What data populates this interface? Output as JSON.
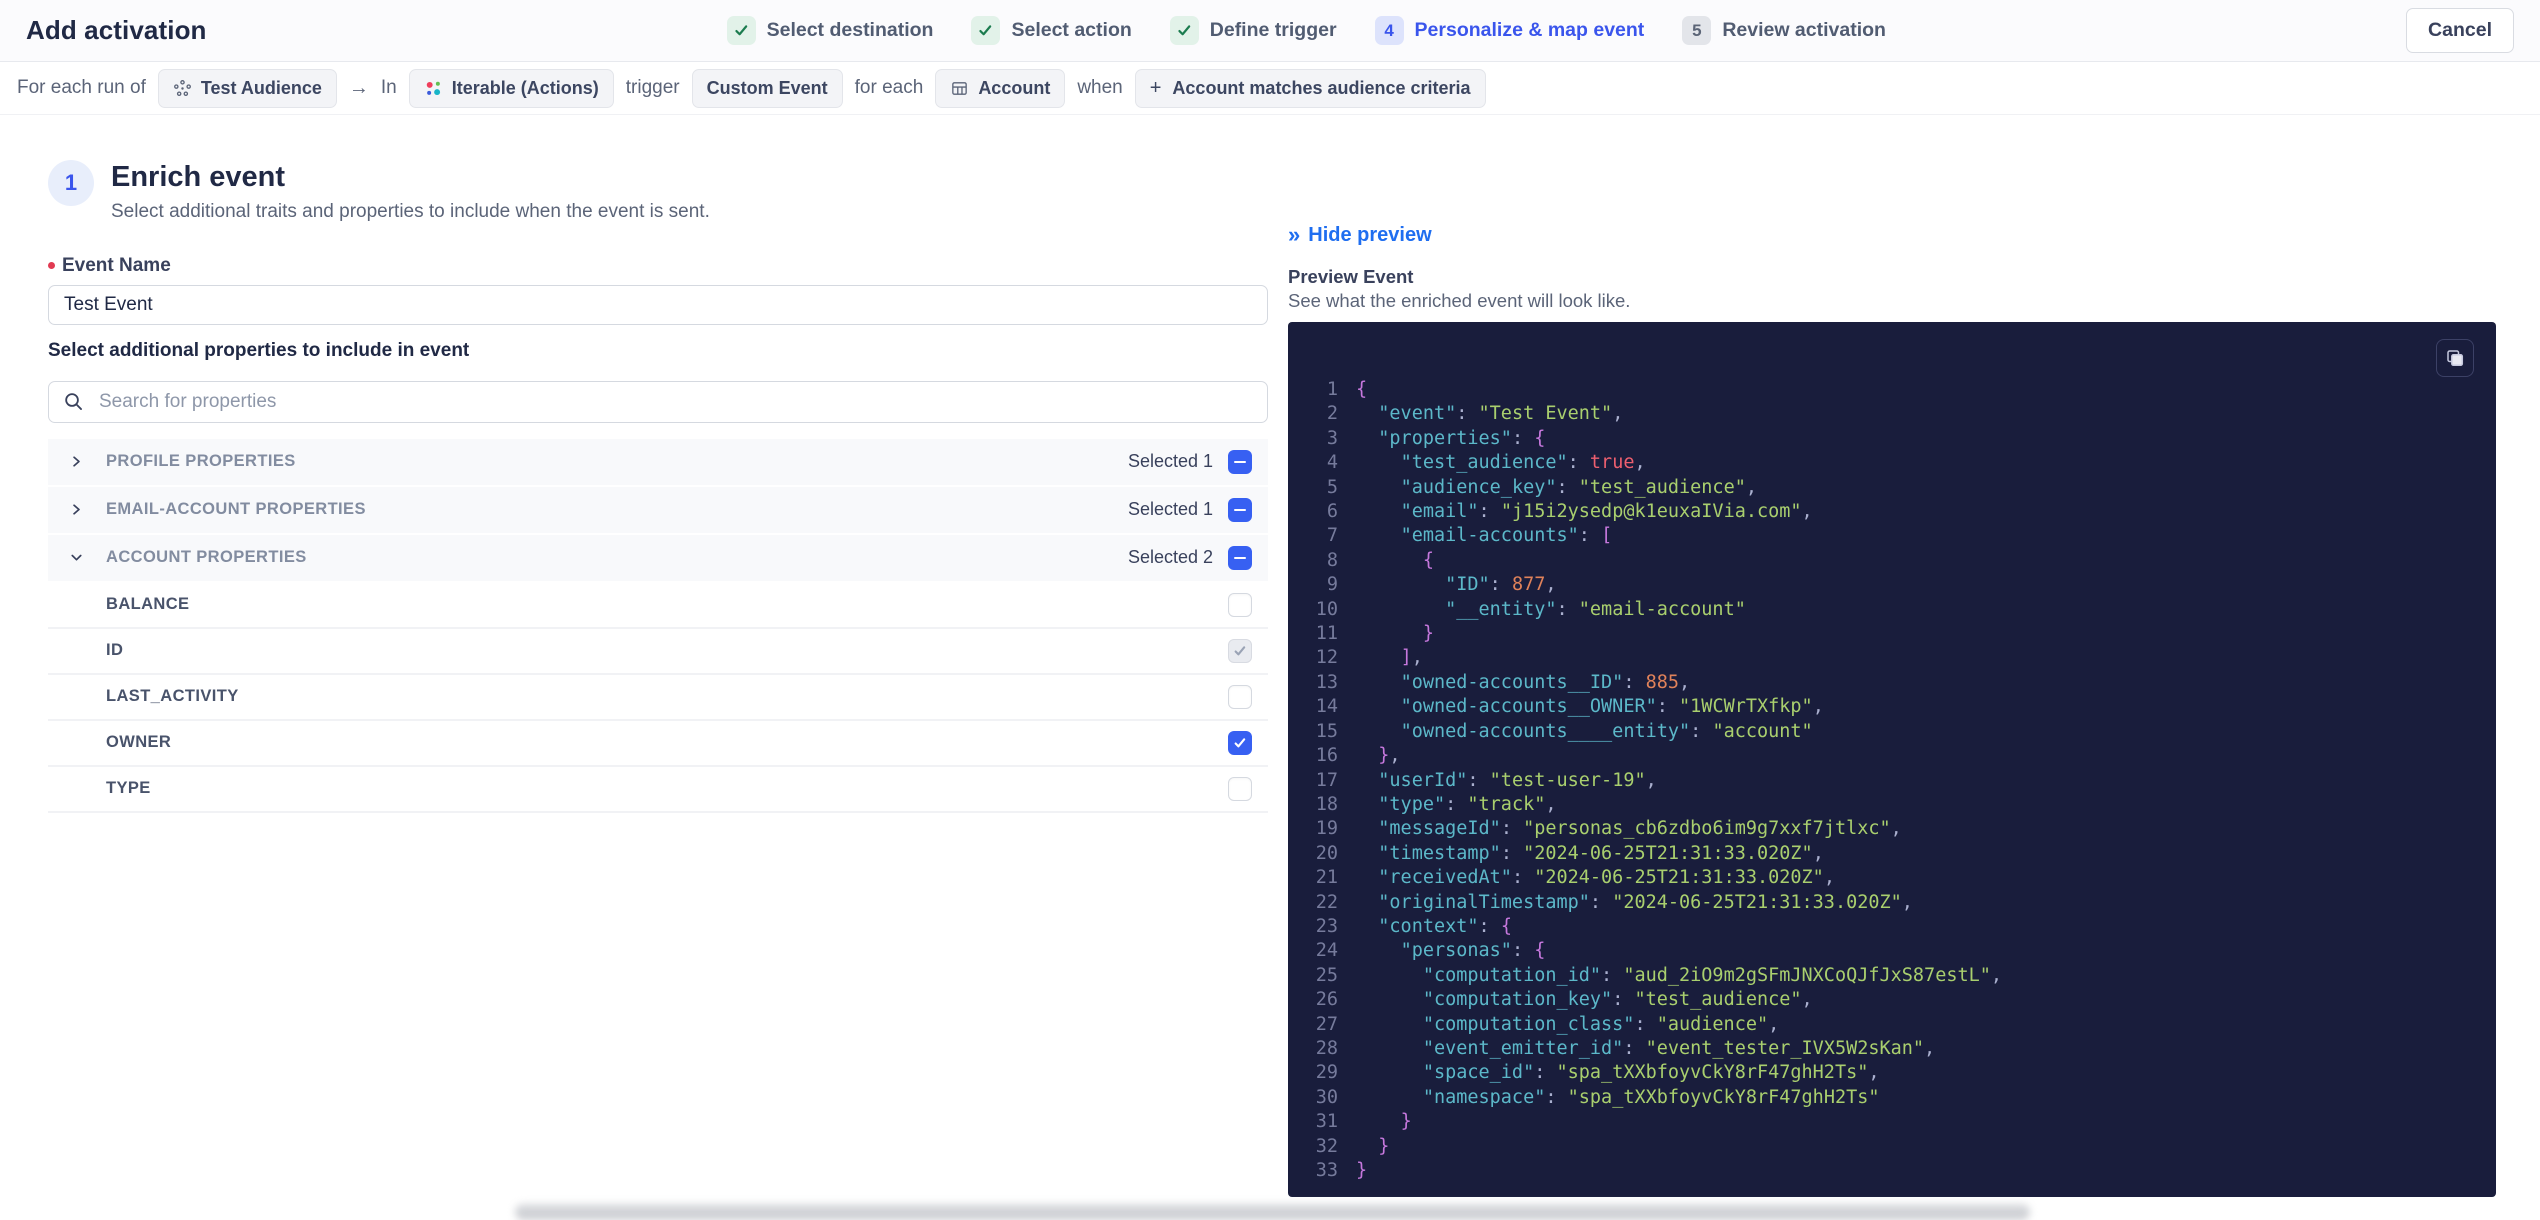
{
  "header": {
    "title": "Add activation",
    "cancel_label": "Cancel",
    "steps": [
      {
        "label": "Select destination",
        "status": "complete"
      },
      {
        "label": "Select action",
        "status": "complete"
      },
      {
        "label": "Define trigger",
        "status": "complete"
      },
      {
        "label": "Personalize & map event",
        "status": "active",
        "number": "4"
      },
      {
        "label": "Review activation",
        "status": "upcoming",
        "number": "5"
      }
    ]
  },
  "trigger_bar": {
    "prefix": "For each run of",
    "audience_pill": "Test Audience",
    "arrow": "→",
    "in_label": "In",
    "destination_pill": "Iterable (Actions)",
    "trigger_label": "trigger",
    "event_pill": "Custom Event",
    "for_each_label": "for each",
    "entity_pill": "Account",
    "when_label": "when",
    "criteria_plus": "+",
    "criteria_pill": "Account matches audience criteria"
  },
  "enrich": {
    "step_number": "1",
    "title": "Enrich event",
    "subtitle": "Select additional traits and properties to include when the event is sent.",
    "event_name_label": "Event Name",
    "event_name_value": "Test Event",
    "properties_label": "Select additional properties to include in event",
    "search_placeholder": "Search for properties",
    "groups": [
      {
        "label": "PROFILE PROPERTIES",
        "selected_text": "Selected 1",
        "expanded": false
      },
      {
        "label": "EMAIL-ACCOUNT PROPERTIES",
        "selected_text": "Selected 1",
        "expanded": false
      },
      {
        "label": "ACCOUNT PROPERTIES",
        "selected_text": "Selected 2",
        "expanded": true
      }
    ],
    "account_properties": [
      {
        "label": "BALANCE",
        "state": "unchecked"
      },
      {
        "label": "ID",
        "state": "checked-disabled"
      },
      {
        "label": "LAST_ACTIVITY",
        "state": "unchecked"
      },
      {
        "label": "OWNER",
        "state": "checked"
      },
      {
        "label": "TYPE",
        "state": "unchecked"
      }
    ]
  },
  "preview": {
    "hide_label": "Hide preview",
    "title": "Preview Event",
    "subtitle": "See what the enriched event will look like.",
    "code_lines": [
      [
        [
          "br",
          "{"
        ]
      ],
      [
        [
          "w",
          "  "
        ],
        [
          "k",
          "\"event\""
        ],
        [
          "p",
          ": "
        ],
        [
          "s",
          "\"Test Event\""
        ],
        [
          "p",
          ","
        ]
      ],
      [
        [
          "w",
          "  "
        ],
        [
          "k",
          "\"properties\""
        ],
        [
          "p",
          ": "
        ],
        [
          "br",
          "{"
        ]
      ],
      [
        [
          "w",
          "    "
        ],
        [
          "k",
          "\"test_audience\""
        ],
        [
          "p",
          ": "
        ],
        [
          "b",
          "true"
        ],
        [
          "p",
          ","
        ]
      ],
      [
        [
          "w",
          "    "
        ],
        [
          "k",
          "\"audience_key\""
        ],
        [
          "p",
          ": "
        ],
        [
          "s",
          "\"test_audience\""
        ],
        [
          "p",
          ","
        ]
      ],
      [
        [
          "w",
          "    "
        ],
        [
          "k",
          "\"email\""
        ],
        [
          "p",
          ": "
        ],
        [
          "s",
          "\"j15i2ysedp@k1euxaIVia.com\""
        ],
        [
          "p",
          ","
        ]
      ],
      [
        [
          "w",
          "    "
        ],
        [
          "k",
          "\"email-accounts\""
        ],
        [
          "p",
          ": "
        ],
        [
          "br",
          "["
        ]
      ],
      [
        [
          "w",
          "      "
        ],
        [
          "br",
          "{"
        ]
      ],
      [
        [
          "w",
          "        "
        ],
        [
          "k",
          "\"ID\""
        ],
        [
          "p",
          ": "
        ],
        [
          "n",
          "877"
        ],
        [
          "p",
          ","
        ]
      ],
      [
        [
          "w",
          "        "
        ],
        [
          "k",
          "\"__entity\""
        ],
        [
          "p",
          ": "
        ],
        [
          "s",
          "\"email-account\""
        ]
      ],
      [
        [
          "w",
          "      "
        ],
        [
          "br",
          "}"
        ]
      ],
      [
        [
          "w",
          "    "
        ],
        [
          "br",
          "]"
        ],
        [
          "p",
          ","
        ]
      ],
      [
        [
          "w",
          "    "
        ],
        [
          "k",
          "\"owned-accounts__ID\""
        ],
        [
          "p",
          ": "
        ],
        [
          "n",
          "885"
        ],
        [
          "p",
          ","
        ]
      ],
      [
        [
          "w",
          "    "
        ],
        [
          "k",
          "\"owned-accounts__OWNER\""
        ],
        [
          "p",
          ": "
        ],
        [
          "s",
          "\"1WCWrTXfkp\""
        ],
        [
          "p",
          ","
        ]
      ],
      [
        [
          "w",
          "    "
        ],
        [
          "k",
          "\"owned-accounts____entity\""
        ],
        [
          "p",
          ": "
        ],
        [
          "s",
          "\"account\""
        ]
      ],
      [
        [
          "w",
          "  "
        ],
        [
          "br",
          "}"
        ],
        [
          "p",
          ","
        ]
      ],
      [
        [
          "w",
          "  "
        ],
        [
          "k",
          "\"userId\""
        ],
        [
          "p",
          ": "
        ],
        [
          "s",
          "\"test-user-19\""
        ],
        [
          "p",
          ","
        ]
      ],
      [
        [
          "w",
          "  "
        ],
        [
          "k",
          "\"type\""
        ],
        [
          "p",
          ": "
        ],
        [
          "s",
          "\"track\""
        ],
        [
          "p",
          ","
        ]
      ],
      [
        [
          "w",
          "  "
        ],
        [
          "k",
          "\"messageId\""
        ],
        [
          "p",
          ": "
        ],
        [
          "s",
          "\"personas_cb6zdbo6im9g7xxf7jtlxc\""
        ],
        [
          "p",
          ","
        ]
      ],
      [
        [
          "w",
          "  "
        ],
        [
          "k",
          "\"timestamp\""
        ],
        [
          "p",
          ": "
        ],
        [
          "s",
          "\"2024-06-25T21:31:33.020Z\""
        ],
        [
          "p",
          ","
        ]
      ],
      [
        [
          "w",
          "  "
        ],
        [
          "k",
          "\"receivedAt\""
        ],
        [
          "p",
          ": "
        ],
        [
          "s",
          "\"2024-06-25T21:31:33.020Z\""
        ],
        [
          "p",
          ","
        ]
      ],
      [
        [
          "w",
          "  "
        ],
        [
          "k",
          "\"originalTimestamp\""
        ],
        [
          "p",
          ": "
        ],
        [
          "s",
          "\"2024-06-25T21:31:33.020Z\""
        ],
        [
          "p",
          ","
        ]
      ],
      [
        [
          "w",
          "  "
        ],
        [
          "k",
          "\"context\""
        ],
        [
          "p",
          ": "
        ],
        [
          "br",
          "{"
        ]
      ],
      [
        [
          "w",
          "    "
        ],
        [
          "k",
          "\"personas\""
        ],
        [
          "p",
          ": "
        ],
        [
          "br",
          "{"
        ]
      ],
      [
        [
          "w",
          "      "
        ],
        [
          "k",
          "\"computation_id\""
        ],
        [
          "p",
          ": "
        ],
        [
          "s",
          "\"aud_2iO9m2gSFmJNXCoQJfJxS87estL\""
        ],
        [
          "p",
          ","
        ]
      ],
      [
        [
          "w",
          "      "
        ],
        [
          "k",
          "\"computation_key\""
        ],
        [
          "p",
          ": "
        ],
        [
          "s",
          "\"test_audience\""
        ],
        [
          "p",
          ","
        ]
      ],
      [
        [
          "w",
          "      "
        ],
        [
          "k",
          "\"computation_class\""
        ],
        [
          "p",
          ": "
        ],
        [
          "s",
          "\"audience\""
        ],
        [
          "p",
          ","
        ]
      ],
      [
        [
          "w",
          "      "
        ],
        [
          "k",
          "\"event_emitter_id\""
        ],
        [
          "p",
          ": "
        ],
        [
          "s",
          "\"event_tester_IVX5W2sKan\""
        ],
        [
          "p",
          ","
        ]
      ],
      [
        [
          "w",
          "      "
        ],
        [
          "k",
          "\"space_id\""
        ],
        [
          "p",
          ": "
        ],
        [
          "s",
          "\"spa_tXXbfoyvCkY8rF47ghH2Ts\""
        ],
        [
          "p",
          ","
        ]
      ],
      [
        [
          "w",
          "      "
        ],
        [
          "k",
          "\"namespace\""
        ],
        [
          "p",
          ": "
        ],
        [
          "s",
          "\"spa_tXXbfoyvCkY8rF47ghH2Ts\""
        ]
      ],
      [
        [
          "w",
          "    "
        ],
        [
          "br",
          "}"
        ]
      ],
      [
        [
          "w",
          "  "
        ],
        [
          "br",
          "}"
        ]
      ],
      [
        [
          "br",
          "}"
        ]
      ]
    ]
  },
  "icons": {
    "stepper_complete": "checkmark-icon",
    "audience_pill": "audience-icon",
    "destination_pill": "iterable-icon",
    "entity_pill": "table-icon",
    "criteria_pill": "plus-icon",
    "search": "search-icon",
    "preview_toggle": "double-chevron-right-icon",
    "code_copy": "copy-icon",
    "group_collapsed": "chevron-right-icon",
    "group_expanded": "chevron-down-icon"
  },
  "colors": {
    "accent_blue": "#3a55ec",
    "link_blue": "#1f6ef0",
    "checkbox_blue": "#3760f2",
    "success_green": "#1c7c4f",
    "success_bg": "#e2f2e9",
    "required_red": "#e13a52",
    "code_bg": "#191d3c",
    "code_key": "#5cb8c9",
    "code_string": "#a9cf6e",
    "code_number": "#e0825a",
    "code_boolean": "#ed5f6f",
    "code_brace": "#c678dd",
    "code_punct": "#aab0cf"
  }
}
